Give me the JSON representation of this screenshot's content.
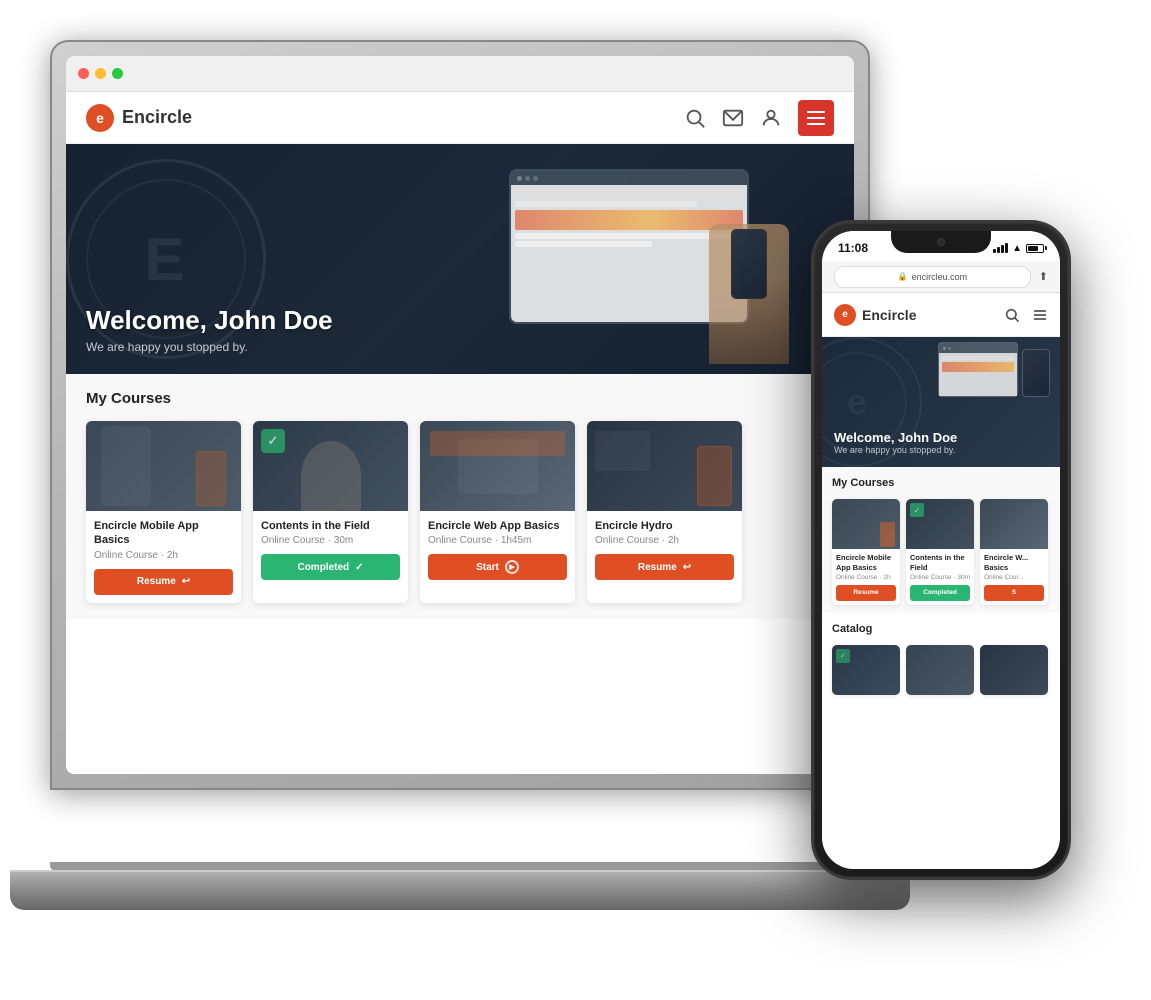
{
  "brand": {
    "name": "Encircle",
    "logo_letter": "e"
  },
  "hero": {
    "title": "Welcome, John Doe",
    "subtitle": "We are happy you stopped by."
  },
  "navbar": {
    "search_label": "Search",
    "menu_label": "Menu"
  },
  "courses_section": {
    "title": "My Courses",
    "courses": [
      {
        "name": "Encircle Mobile App Basics",
        "type": "Online Course",
        "duration": "2h",
        "button_label": "Resume",
        "button_type": "resume",
        "completed": false
      },
      {
        "name": "Contents in the Field",
        "type": "Online Course",
        "duration": "30m",
        "button_label": "Completed",
        "button_type": "completed",
        "completed": true
      },
      {
        "name": "Encircle Web App Basics",
        "type": "Online Course",
        "duration": "1h45m",
        "button_label": "Start",
        "button_type": "start",
        "completed": false
      },
      {
        "name": "Encircle Hydro",
        "type": "Online Course",
        "duration": "2h",
        "button_label": "Resume",
        "button_type": "resume",
        "completed": false
      }
    ]
  },
  "phone": {
    "status_bar": {
      "time": "11:08",
      "url": "encircleu.com"
    },
    "hero": {
      "title": "Welcome, John Doe",
      "subtitle": "We are happy you stopped by."
    },
    "courses_section": {
      "title": "My Courses",
      "courses": [
        {
          "name": "Encircle Mobile App Basics",
          "type": "Online Course",
          "duration": "2h",
          "button_label": "Resume",
          "button_type": "resume"
        },
        {
          "name": "Contents in the Field",
          "type": "Online Course",
          "duration": "30m",
          "button_label": "Completed",
          "button_type": "completed"
        },
        {
          "name": "Encircle Web App Basics",
          "type": "Online Course",
          "duration": "",
          "button_label": "S",
          "button_type": "start"
        }
      ]
    },
    "catalog": {
      "title": "Catalog"
    }
  },
  "colors": {
    "primary": "#e04e23",
    "completed": "#2ab573",
    "dark_bg": "#1a2535"
  }
}
